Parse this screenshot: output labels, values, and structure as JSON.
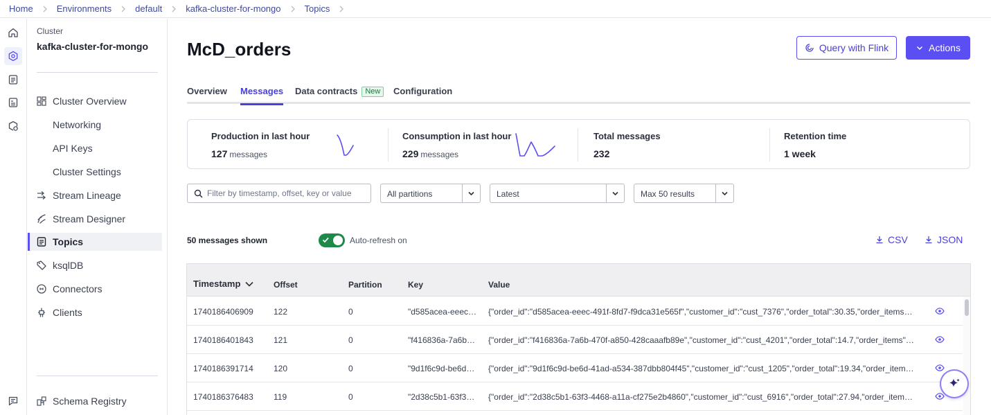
{
  "breadcrumb": {
    "items": [
      "Home",
      "Environments",
      "default",
      "kafka-cluster-for-mongo",
      "Topics"
    ]
  },
  "sidebar": {
    "cluster_label": "Cluster",
    "cluster_name": "kafka-cluster-for-mongo",
    "items": [
      {
        "label": "Cluster Overview",
        "icon": "dashboard-icon"
      },
      {
        "label": "Networking",
        "icon": ""
      },
      {
        "label": "API Keys",
        "icon": ""
      },
      {
        "label": "Cluster Settings",
        "icon": ""
      },
      {
        "label": "Stream Lineage",
        "icon": "lineage-icon"
      },
      {
        "label": "Stream Designer",
        "icon": "designer-icon"
      },
      {
        "label": "Topics",
        "icon": "topics-icon",
        "active": true
      },
      {
        "label": "ksqlDB",
        "icon": "ksqldb-icon"
      },
      {
        "label": "Connectors",
        "icon": "connectors-icon"
      },
      {
        "label": "Clients",
        "icon": "clients-icon"
      }
    ],
    "footer_item": {
      "label": "Schema Registry",
      "icon": "schema-registry-icon"
    }
  },
  "header": {
    "title": "McD_orders",
    "query_flink_label": "Query with Flink",
    "actions_label": "Actions"
  },
  "tabs": [
    {
      "label": "Overview"
    },
    {
      "label": "Messages",
      "active": true
    },
    {
      "label": "Data contracts",
      "badge": "New"
    },
    {
      "label": "Configuration"
    }
  ],
  "stats": {
    "production": {
      "label": "Production in last hour",
      "value": "127",
      "unit": "messages"
    },
    "consumption": {
      "label": "Consumption in last hour",
      "value": "229",
      "unit": "messages"
    },
    "total": {
      "label": "Total messages",
      "value": "232"
    },
    "retention": {
      "label": "Retention time",
      "value": "1 week"
    }
  },
  "filters": {
    "search_placeholder": "Filter by timestamp, offset, key or value",
    "partitions": "All partitions",
    "offset_mode": "Latest",
    "max_results": "Max 50 results"
  },
  "messages_bar": {
    "shown_text": "50 messages shown",
    "auto_refresh_label": "Auto-refresh on",
    "auto_refresh_on": true,
    "csv_label": "CSV",
    "json_label": "JSON"
  },
  "table": {
    "columns": [
      "Timestamp",
      "Offset",
      "Partition",
      "Key",
      "Value"
    ],
    "rows": [
      {
        "timestamp": "1740186406909",
        "offset": "122",
        "partition": "0",
        "key": "\"d585acea-eeec-4...",
        "value": "{\"order_id\":\"d585acea-eeec-491f-8fd7-f9dca31e565f\",\"customer_id\":\"cust_7376\",\"order_total\":30.35,\"order_items\":[{\"item_na..."
      },
      {
        "timestamp": "1740186401843",
        "offset": "121",
        "partition": "0",
        "key": "\"f416836a-7a6b-4...",
        "value": "{\"order_id\":\"f416836a-7a6b-470f-a850-428caaafb89e\",\"customer_id\":\"cust_4201\",\"order_total\":14.7,\"order_items\":[{\"item_nam..."
      },
      {
        "timestamp": "1740186391714",
        "offset": "120",
        "partition": "0",
        "key": "\"9d1f6c9d-be6d-4...",
        "value": "{\"order_id\":\"9d1f6c9d-be6d-41ad-a534-387dbb804f45\",\"customer_id\":\"cust_1205\",\"order_total\":19.34,\"order_items\":[{\"item_n..."
      },
      {
        "timestamp": "1740186376483",
        "offset": "119",
        "partition": "0",
        "key": "\"2d38c5b1-63f3-4...",
        "value": "{\"order_id\":\"2d38c5b1-63f3-4468-a11a-cf275e2b4860\",\"customer_id\":\"cust_6916\",\"order_total\":27.94,\"order_items\":[{\"item_na..."
      }
    ]
  },
  "colors": {
    "accent": "#5b4ef2",
    "link": "#3f4a9e",
    "toggle_on": "#1e8a4a",
    "new_badge": "#1d7a42"
  }
}
